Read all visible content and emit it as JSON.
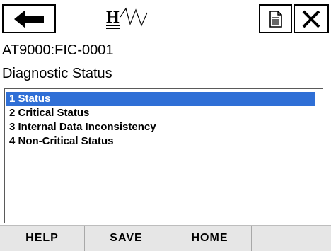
{
  "toolbar": {
    "back_icon": "left-arrow-icon",
    "logo_icon": "hart-logo-icon",
    "document_icon": "document-icon",
    "close_icon": "close-icon"
  },
  "device_tag": "AT9000:FIC-0001",
  "screen_title": "Diagnostic Status",
  "menu": {
    "selected_index": 0,
    "items": [
      {
        "label": "1 Status"
      },
      {
        "label": "2 Critical Status"
      },
      {
        "label": "3 Internal Data Inconsistency"
      },
      {
        "label": "4 Non-Critical Status"
      }
    ]
  },
  "softkeys": [
    {
      "label": "HELP"
    },
    {
      "label": "SAVE"
    },
    {
      "label": "HOME"
    },
    {
      "label": ""
    }
  ],
  "colors": {
    "selection": "#2f6fd6",
    "softkey_bar": "#e6e6e6"
  }
}
